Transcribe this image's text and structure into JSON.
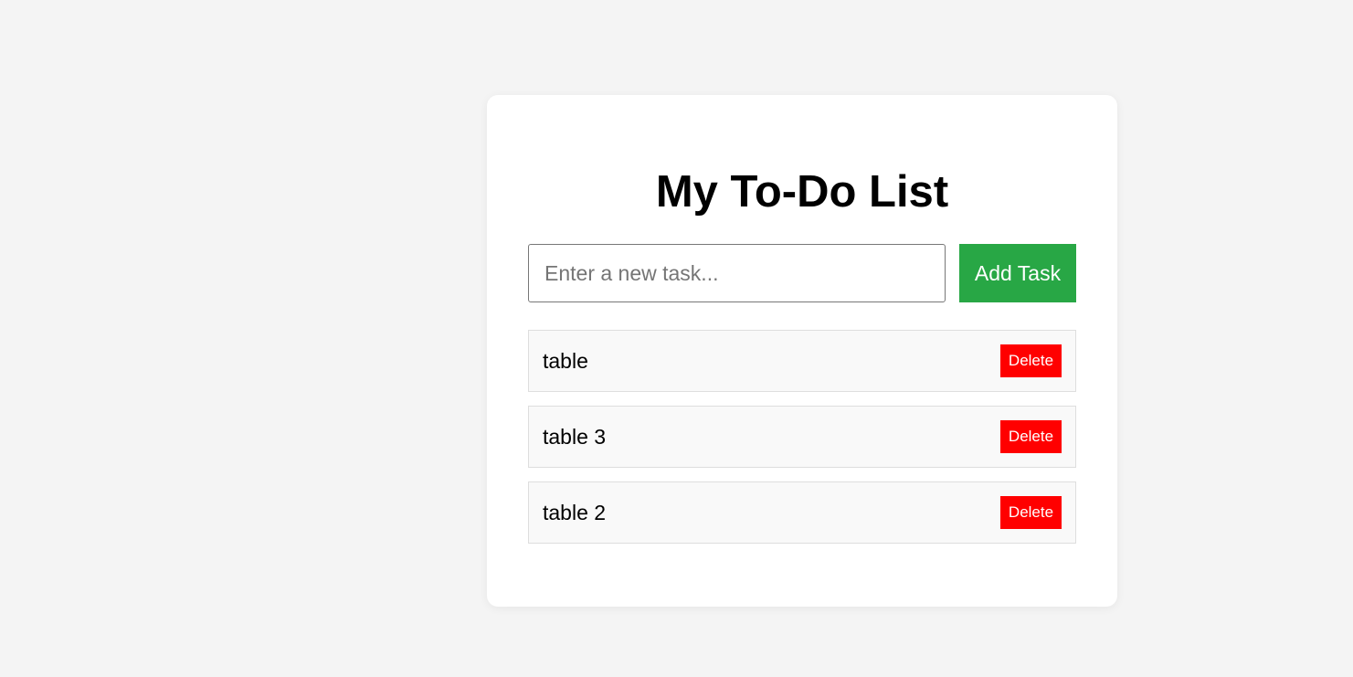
{
  "app": {
    "title": "My To-Do List"
  },
  "input": {
    "placeholder": "Enter a new task...",
    "value": ""
  },
  "add_button": {
    "label": "Add Task"
  },
  "tasks": [
    {
      "text": "table",
      "delete_label": "Delete"
    },
    {
      "text": "table 3",
      "delete_label": "Delete"
    },
    {
      "text": "table 2",
      "delete_label": "Delete"
    }
  ],
  "colors": {
    "background": "#f4f4f4",
    "card": "#ffffff",
    "add_button": "#28a745",
    "delete_button": "#ff0000",
    "task_item_bg": "#f9f9f9"
  }
}
